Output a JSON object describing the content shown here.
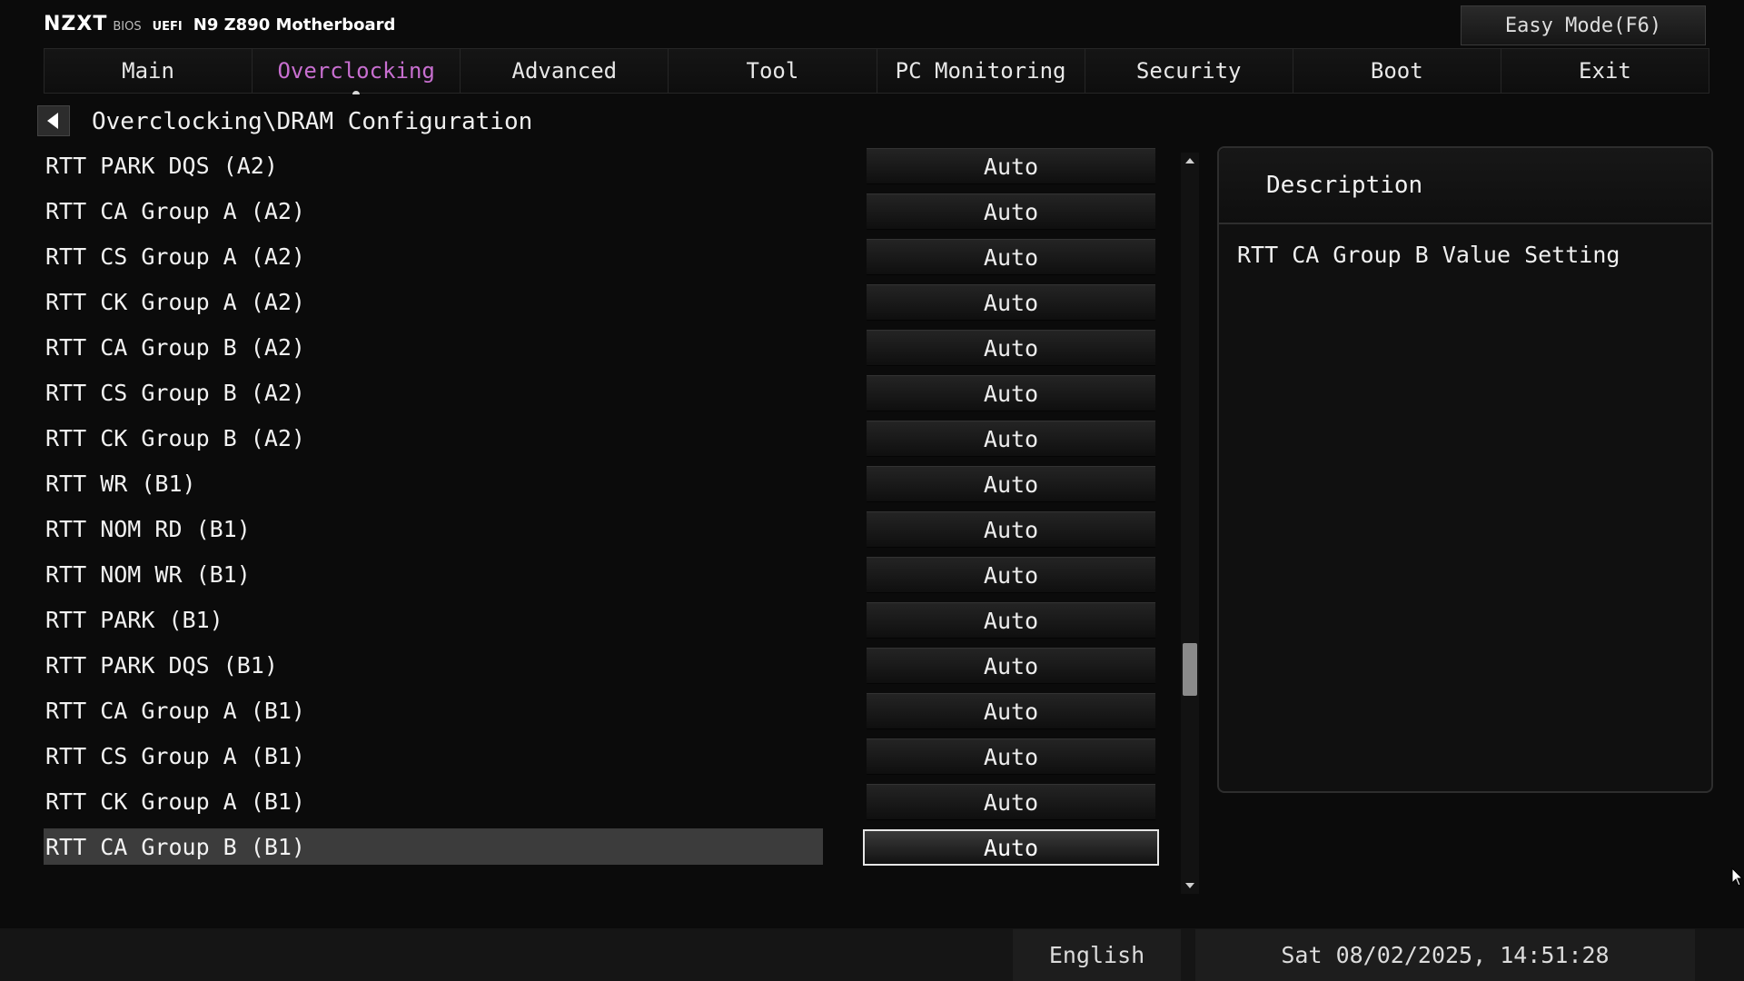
{
  "header": {
    "logo": "NZXT",
    "bios": "BIOS",
    "uefi": "UEFI",
    "model": "N9 Z890 Motherboard",
    "easy_mode_label": "Easy Mode(F6)"
  },
  "tabs": [
    {
      "label": "Main",
      "active": false
    },
    {
      "label": "Overclocking",
      "active": true
    },
    {
      "label": "Advanced",
      "active": false
    },
    {
      "label": "Tool",
      "active": false
    },
    {
      "label": "PC Monitoring",
      "active": false
    },
    {
      "label": "Security",
      "active": false
    },
    {
      "label": "Boot",
      "active": false
    },
    {
      "label": "Exit",
      "active": false
    }
  ],
  "breadcrumb": "Overclocking\\DRAM Configuration",
  "settings": [
    {
      "label": "RTT PARK DQS (A2)",
      "value": "Auto"
    },
    {
      "label": "RTT CA Group A (A2)",
      "value": "Auto"
    },
    {
      "label": "RTT CS Group A (A2)",
      "value": "Auto"
    },
    {
      "label": "RTT CK Group A (A2)",
      "value": "Auto"
    },
    {
      "label": "RTT CA Group B (A2)",
      "value": "Auto"
    },
    {
      "label": "RTT CS Group B (A2)",
      "value": "Auto"
    },
    {
      "label": "RTT CK Group B (A2)",
      "value": "Auto"
    },
    {
      "label": "RTT WR (B1)",
      "value": "Auto"
    },
    {
      "label": "RTT NOM RD (B1)",
      "value": "Auto"
    },
    {
      "label": "RTT NOM WR (B1)",
      "value": "Auto"
    },
    {
      "label": "RTT PARK (B1)",
      "value": "Auto"
    },
    {
      "label": "RTT PARK DQS (B1)",
      "value": "Auto"
    },
    {
      "label": "RTT CA Group A (B1)",
      "value": "Auto"
    },
    {
      "label": "RTT CS Group A (B1)",
      "value": "Auto"
    },
    {
      "label": "RTT CK Group A (B1)",
      "value": "Auto"
    },
    {
      "label": "RTT CA Group B (B1)",
      "value": "Auto",
      "selected": true
    }
  ],
  "description": {
    "title": "Description",
    "text": "RTT CA Group B Value Setting"
  },
  "status": {
    "language": "English",
    "datetime": "Sat 08/02/2025, 14:51:28"
  },
  "colors": {
    "accent": "#c86fd0",
    "background": "#0b0b0b",
    "selected_row": "#3c3c3c"
  },
  "scroll": {
    "position_fraction": 0.72
  }
}
